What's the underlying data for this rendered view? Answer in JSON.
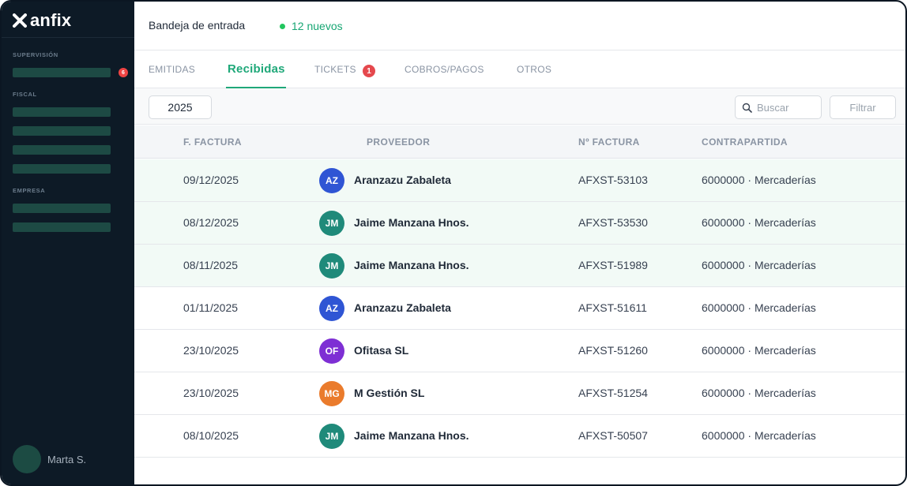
{
  "app": {
    "brand": "anfix"
  },
  "sidebar": {
    "sections": [
      {
        "label": "SUPERVISIÓN"
      },
      {
        "label": "FISCAL"
      },
      {
        "label": "EMPRESA"
      }
    ],
    "badge": "6",
    "user": {
      "name": "Marta S."
    }
  },
  "header": {
    "title": "Bandeja de entrada",
    "new_count": "12 nuevos",
    "status_color": "#22c55e"
  },
  "tabs": [
    {
      "label": "EMITIDAS",
      "active": false
    },
    {
      "label": "Recibidas",
      "active": true
    },
    {
      "label": "TICKETS",
      "active": false,
      "badge": "1"
    },
    {
      "label": "COBROS/PAGOS",
      "active": false
    },
    {
      "label": "OTROS",
      "active": false
    }
  ],
  "toolbar": {
    "year": "2025",
    "search_placeholder": "Buscar",
    "filter_label": "Filtrar"
  },
  "table": {
    "columns": [
      "F. FACTURA",
      "PROVEEDOR",
      "Nº FACTURA",
      "CONTRAPARTIDA"
    ],
    "rows": [
      {
        "date": "09/12/2025",
        "initials": "AZ",
        "avatar_color": "#2f55d4",
        "supplier": "Aranzazu Zabaleta",
        "invoice": "AFXST-53103",
        "account": "6000000 · Mercaderías",
        "highlight": true
      },
      {
        "date": "08/12/2025",
        "initials": "JM",
        "avatar_color": "#1f8a7a",
        "supplier": "Jaime Manzana Hnos.",
        "invoice": "AFXST-53530",
        "account": "6000000 · Mercaderías",
        "highlight": true
      },
      {
        "date": "08/11/2025",
        "initials": "JM",
        "avatar_color": "#1f8a7a",
        "supplier": "Jaime Manzana Hnos.",
        "invoice": "AFXST-51989",
        "account": "6000000 · Mercaderías",
        "highlight": true
      },
      {
        "date": "01/11/2025",
        "initials": "AZ",
        "avatar_color": "#2f55d4",
        "supplier": "Aranzazu Zabaleta",
        "invoice": "AFXST-51611",
        "account": "6000000 · Mercaderías",
        "highlight": false
      },
      {
        "date": "23/10/2025",
        "initials": "OF",
        "avatar_color": "#7e2fd4",
        "supplier": "Ofitasa SL",
        "invoice": "AFXST-51260",
        "account": "6000000 · Mercaderías",
        "highlight": false
      },
      {
        "date": "23/10/2025",
        "initials": "MG",
        "avatar_color": "#ea7b2c",
        "supplier": "M Gestión SL",
        "invoice": "AFXST-51254",
        "account": "6000000 · Mercaderías",
        "highlight": false
      },
      {
        "date": "08/10/2025",
        "initials": "JM",
        "avatar_color": "#1f8a7a",
        "supplier": "Jaime Manzana Hnos.",
        "invoice": "AFXST-50507",
        "account": "6000000 · Mercaderías",
        "highlight": false
      }
    ]
  },
  "colors": {
    "accent": "#1fa879",
    "sidebar_bg": "#0d1a26",
    "badge": "#e5484d"
  }
}
